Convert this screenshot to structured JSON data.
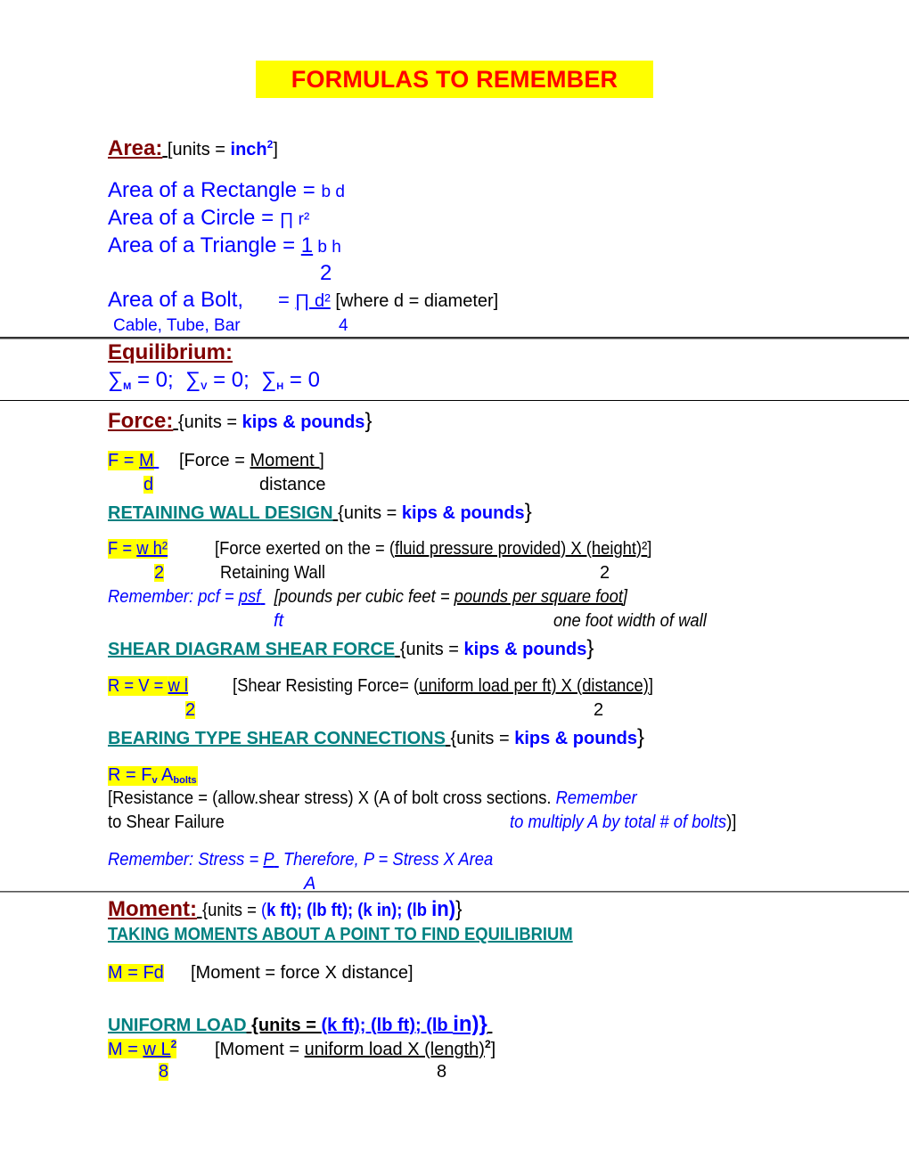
{
  "title": "FORMULAS TO REMEMBER",
  "area": {
    "heading": "Area:",
    "units_prefix": "[units = ",
    "units_value": "inch",
    "units_sup": "2",
    "units_suffix": "]",
    "rectangle": {
      "label": "Area of a Rectangle = ",
      "formula": "b d"
    },
    "circle": {
      "label": "Area of a Circle = ",
      "formula": "∏ r²"
    },
    "triangle": {
      "label": "Area of a Triangle = ",
      "numerator": "1",
      "rest": " b h",
      "denominator": "2"
    },
    "bolt": {
      "label": "Area of a Bolt,",
      "equals": "= ",
      "numerator": "∏ d²",
      "note": " [where d = diameter]",
      "sublabel": "Cable, Tube, Bar",
      "denominator": "4"
    }
  },
  "equilibrium": {
    "heading": "Equilibrium:",
    "terms": [
      {
        "symbol": "∑",
        "sub": "M",
        "rest": " = 0;"
      },
      {
        "symbol": "∑",
        "sub": "V",
        "rest": " = 0;"
      },
      {
        "symbol": "∑",
        "sub": "H",
        "rest": " = 0"
      }
    ]
  },
  "force": {
    "heading": "Force:",
    "units_prefix": "{units = ",
    "units_value": "kips & pounds",
    "units_suffix": "}",
    "formula": {
      "lhs": "F = ",
      "numerator": "M",
      "denominator": "d"
    },
    "desc": {
      "prefix": "[Force = ",
      "numerator": "Moment ]",
      "denominator": "distance"
    }
  },
  "retaining_wall": {
    "heading": "RETAINING WALL DESIGN",
    "units_prefix": "{units = ",
    "units_value": "kips & pounds",
    "units_suffix": "}",
    "formula": {
      "lhs": "F = ",
      "numerator": "w h²",
      "denominator": "2"
    },
    "desc_line1": "[Force exerted on the   = (",
    "desc_underlined": "fluid pressure provided) X (height)²",
    "desc_close": "]",
    "desc_line2": "Retaining Wall",
    "desc_denominator": "2",
    "remember": {
      "prefix": "Remember: pcf = ",
      "numerator": "psf",
      "denominator": "ft",
      "bracket": "[pounds per cubic feet = ",
      "underlined": "pounds per square foot",
      "close": "]",
      "sub": "one foot width of wall"
    }
  },
  "shear_diagram": {
    "heading": "SHEAR DIAGRAM SHEAR FORCE",
    "units_prefix": "{units = ",
    "units_value": "kips & pounds",
    "units_suffix": "}",
    "formula": {
      "lhs": "R = V = ",
      "numerator": "w l",
      "denominator": "2"
    },
    "desc_prefix": "[Shear Resisting Force= (",
    "desc_underlined": "uniform load per ft) X (distance)",
    "desc_close": "]",
    "desc_denominator": "2"
  },
  "bearing": {
    "heading": "BEARING TYPE SHEAR CONNECTIONS",
    "units_prefix": "{units = ",
    "units_value": "kips & pounds",
    "units_suffix": "}",
    "formula": {
      "lhs": "R = F",
      "sub1": "v",
      "mid": " A",
      "sub2": "bolts"
    },
    "desc_line1": "[Resistance = (allow.shear stress) X (A of bolt cross sections. ",
    "desc_remember": "Remember",
    "desc_line2": " to Shear Failure",
    "desc_remember2": "to multiply A by total # of bolts",
    "desc_close": ")]",
    "stress": {
      "prefix": "Remember: Stress = ",
      "numerator": "P",
      "rest": "  Therefore, P = Stress X Area",
      "denominator": "A"
    }
  },
  "moment": {
    "heading": "Moment:",
    "units_prefix": "{units = ",
    "units_open": "(",
    "units_list": "k ft); (lb ft); (",
    "units_k_in": "k in); (lb ",
    "units_in": "in)",
    "units_suffix": "}",
    "taking_moments": "TAKING MOMENTS ABOUT A POINT TO FIND EQUILIBRIUM",
    "formula": "M = Fd",
    "desc": "[Moment = force X distance]"
  },
  "uniform_load": {
    "heading": "UNIFORM LOAD",
    "units_prefix": "{units = ",
    "units_value": "(k ft); (lb ft); (lb ",
    "units_in": "in)}",
    "formula": {
      "lhs": "M = ",
      "numerator": "w L",
      "sup": "2",
      "denominator": "8"
    },
    "desc_prefix": "[Moment = ",
    "desc_underlined": "uniform load X (length)",
    "desc_sup": "2",
    "desc_close": "]",
    "desc_denominator": "8"
  }
}
